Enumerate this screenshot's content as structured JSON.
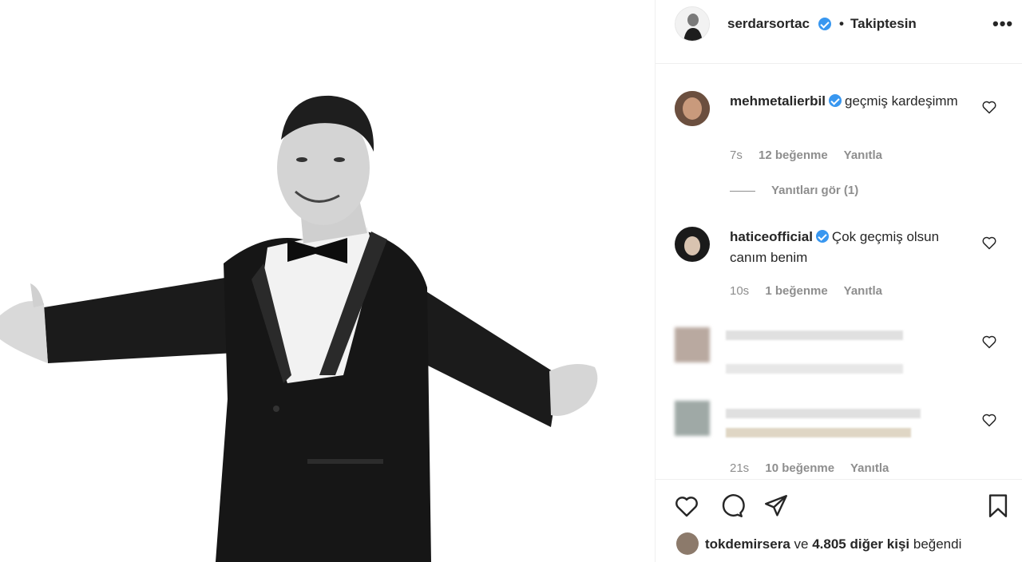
{
  "post": {
    "author": "serdarsortac",
    "separator": "•",
    "follow_status": "Takiptesin",
    "more_label": "•••"
  },
  "comments": [
    {
      "username": "mehmetalierbil",
      "text": "geçmiş kardeşimm",
      "time": "7s",
      "likes": "12 beğenme",
      "reply": "Yanıtla",
      "view_replies": "Yanıtları gör (1)"
    },
    {
      "username": "haticeofficial",
      "text": "Çok geçmiş olsun canım benim",
      "time": "10s",
      "likes": "1 beğenme",
      "reply": "Yanıtla"
    },
    {
      "time": "21s",
      "likes": "10 beğenme",
      "reply": "Yanıtla"
    }
  ],
  "likes_line": {
    "user": "tokdemirsera",
    "connector": "ve",
    "others": "4.805 diğer kişi",
    "suffix": "beğendi"
  },
  "icons": {
    "more": "more-horizontal-icon",
    "verified": "verified-badge-icon",
    "like": "heart-icon",
    "comment": "comment-bubble-icon",
    "share": "paper-plane-icon",
    "save": "bookmark-icon"
  },
  "colors": {
    "verified_blue": "#3897f0",
    "muted_text": "#8e8e8e",
    "text": "#262626",
    "divider": "#efefef"
  }
}
